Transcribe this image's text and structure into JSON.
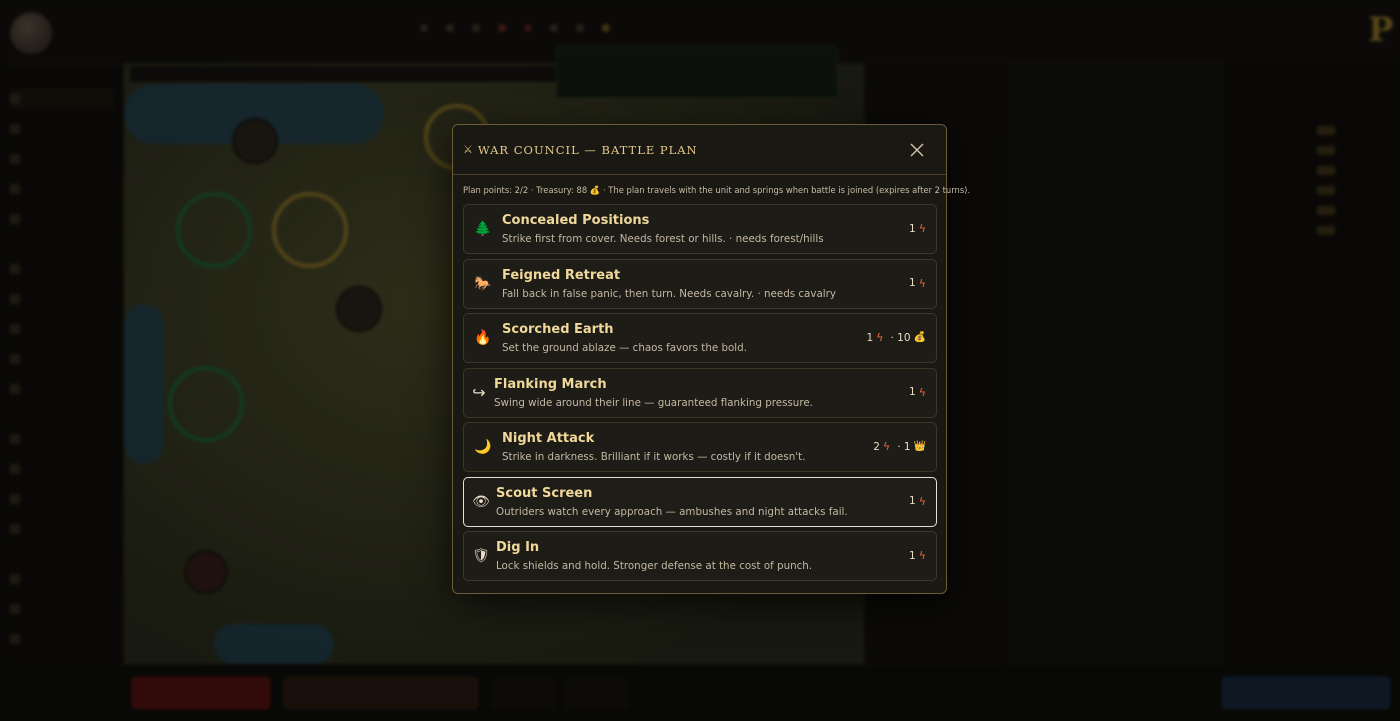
{
  "modal": {
    "title": "WAR COUNCIL — BATTLE PLAN",
    "summary": {
      "plan_points": "Plan points: 2/2 · Treasury: 88",
      "note": "· The plan travels with the unit and springs when battle is joined (expires after 2 turns)."
    },
    "plans": [
      {
        "title": "Concealed Positions",
        "desc": "Strike first from cover. Needs forest or hills. · needs forest/hills",
        "cost": "1",
        "icon": "tree-icon",
        "glyph": "🌲",
        "selected": false
      },
      {
        "title": "Feigned Retreat",
        "desc": "Fall back in false panic, then turn. Needs cavalry. · needs cavalry",
        "cost": "1",
        "icon": "horse-icon",
        "glyph": "🐎",
        "selected": false
      },
      {
        "title": "Scorched Earth",
        "desc": "Set the ground ablaze — chaos favors the bold.",
        "cost": "1",
        "extra_cost": "· 10",
        "extra_icon": "coin-icon",
        "extra_glyph": "💰",
        "icon": "fire-icon",
        "glyph": "🔥",
        "selected": false
      },
      {
        "title": "Flanking March",
        "desc": "Swing wide around their line — guaranteed flanking pressure.",
        "cost": "1",
        "icon": "flank-arrow-icon",
        "glyph": "↪",
        "selected": false
      },
      {
        "title": "Night Attack",
        "desc": "Strike in darkness. Brilliant if it works — costly if it doesn't.",
        "cost": "2",
        "extra_cost": "· 1",
        "extra_icon": "crown-icon",
        "extra_glyph": "👑",
        "icon": "moon-icon",
        "glyph": "🌙",
        "selected": false
      },
      {
        "title": "Scout Screen",
        "desc": "Outriders watch every approach — ambushes and night attacks fail.",
        "cost": "1",
        "icon": "eye-icon",
        "glyph": "👁",
        "selected": true
      },
      {
        "title": "Dig In",
        "desc": "Lock shields and hold. Stronger defense at the cost of punch.",
        "cost": "1",
        "icon": "shield-icon",
        "glyph": "🛡",
        "selected": false
      }
    ]
  },
  "colors": {
    "accent_gold": "#e6c98a",
    "bolt": "#e9673a",
    "selected_border": "#e9e2d2"
  }
}
